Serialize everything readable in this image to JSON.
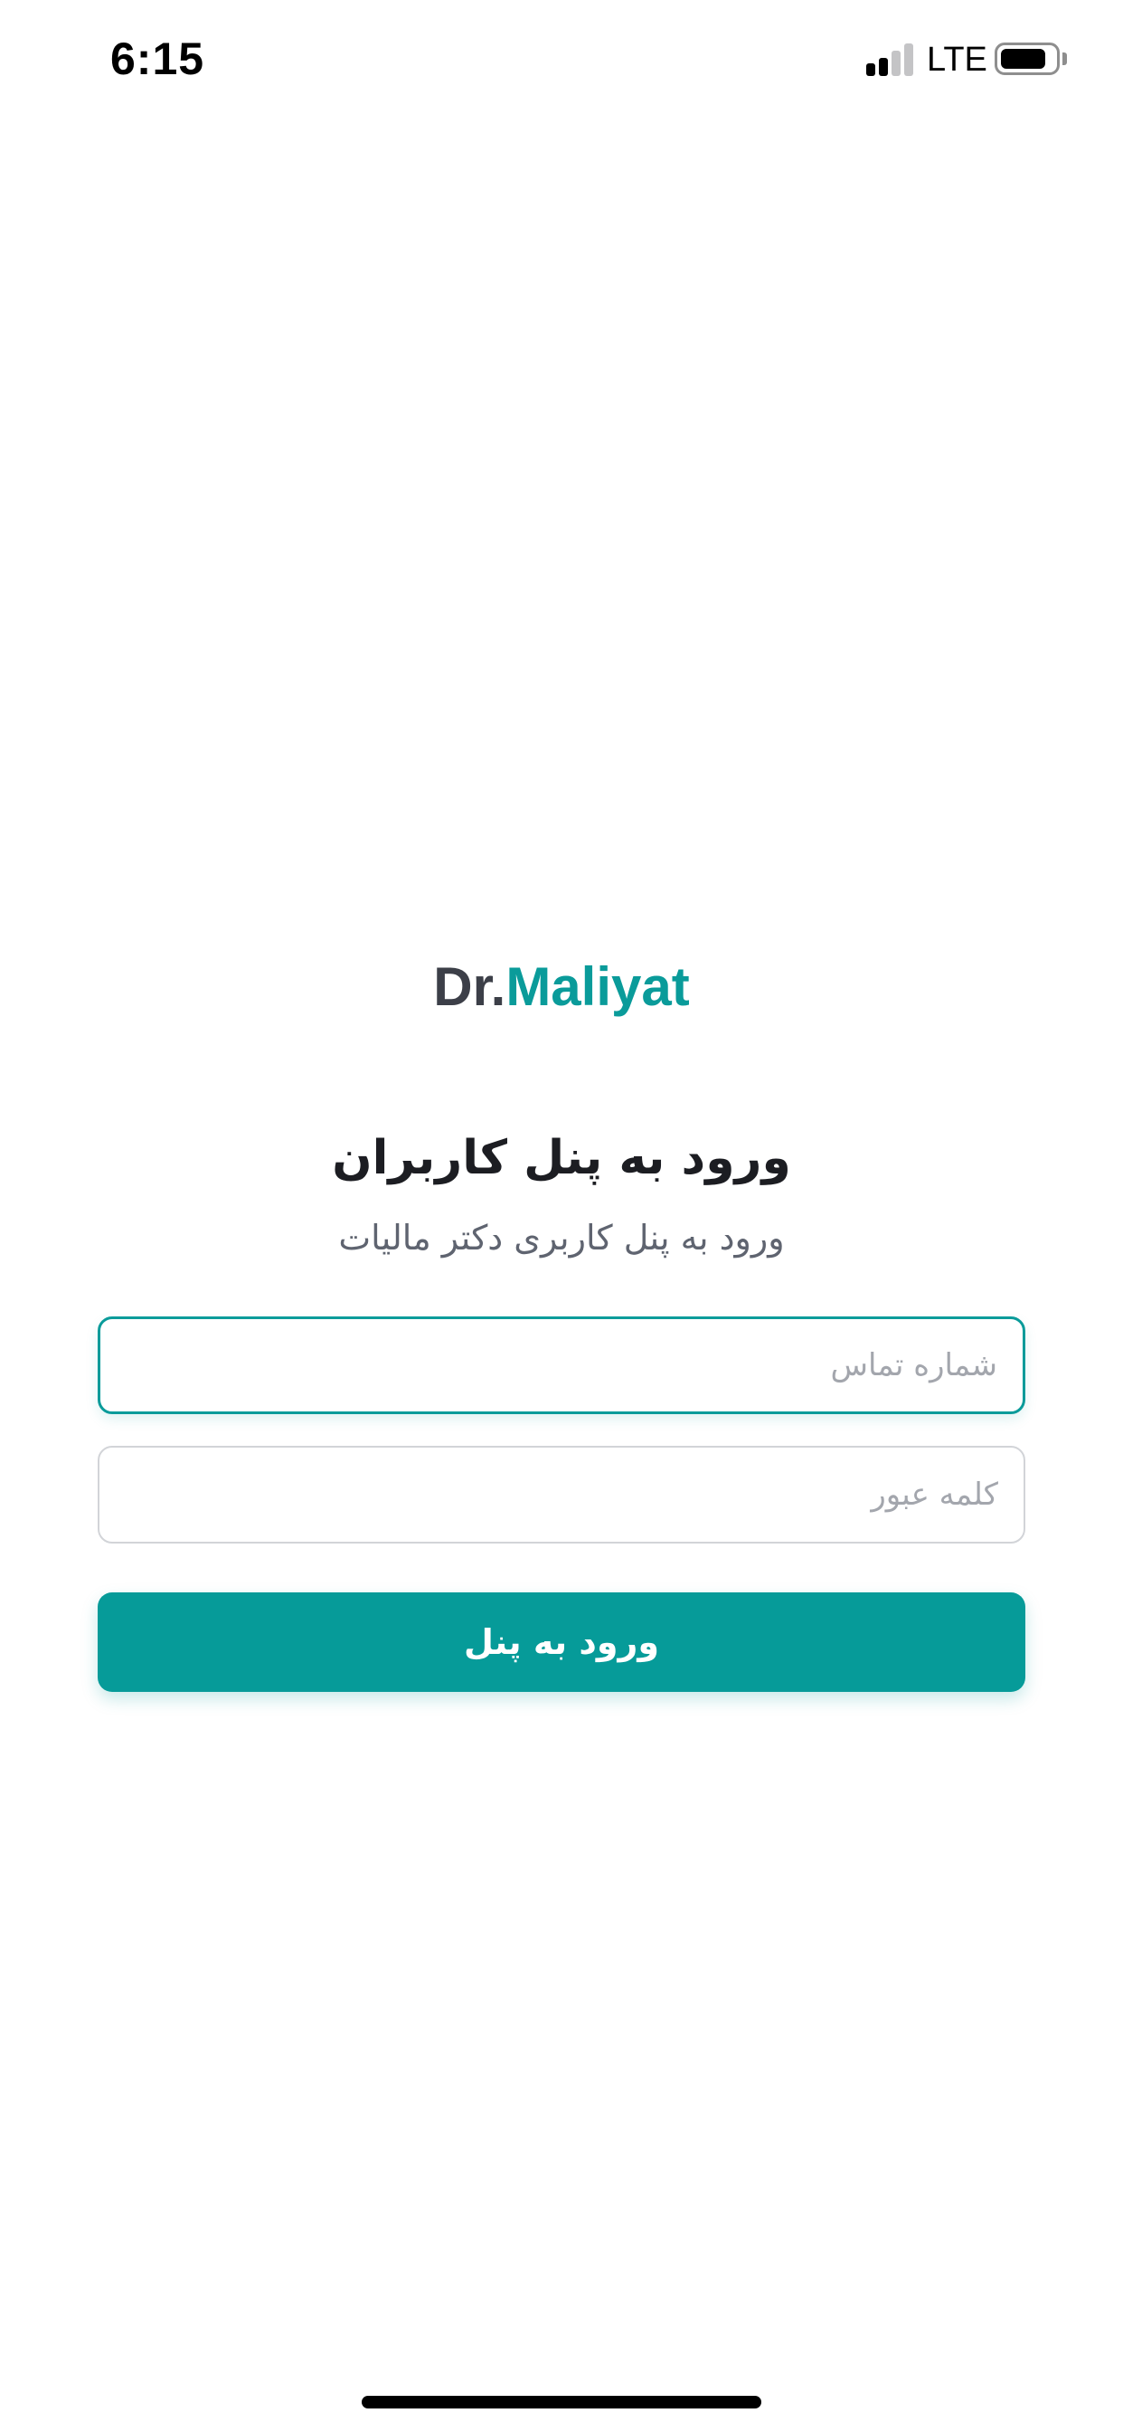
{
  "status_bar": {
    "time": "6:15",
    "network": "LTE",
    "signal_bars_active": 2,
    "signal_bars_total": 4,
    "battery_level": 0.85
  },
  "logo": {
    "prefix": "Dr.",
    "name": "Maliyat",
    "prefix_color": "#3c3f48",
    "name_color": "#0a9b9a"
  },
  "login": {
    "title": "ورود به پنل کاربران",
    "subtitle": "ورود به پنل کاربری دکتر مالیات",
    "phone_placeholder": "شماره تماس",
    "phone_value": "",
    "password_placeholder": "کلمه عبور",
    "password_value": "",
    "submit_label": "ورود به پنل"
  },
  "colors": {
    "accent": "#069b99",
    "focus_border": "#0a9b9a",
    "input_border": "#d2d4d8"
  }
}
